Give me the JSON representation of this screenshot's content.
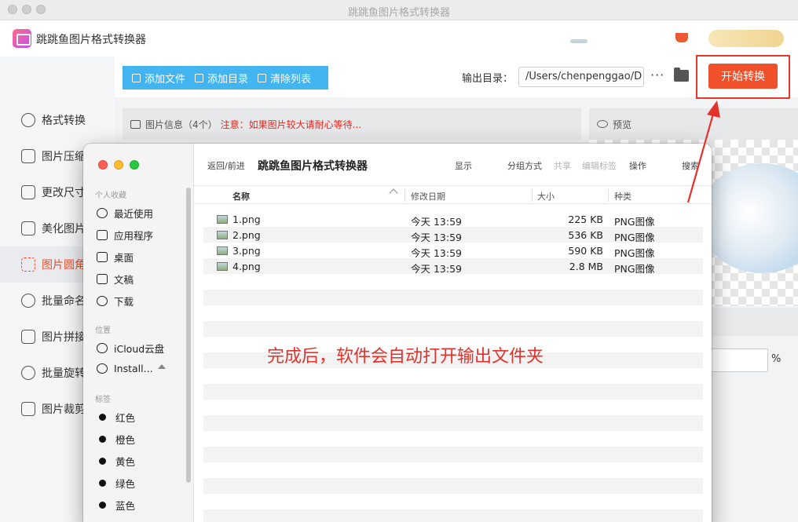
{
  "window": {
    "title": "跳跳鱼图片格式转换器"
  },
  "app": {
    "name": "跳跳鱼图片格式转换器"
  },
  "sidebar": {
    "items": [
      {
        "label": "格式转换",
        "icon": "format-convert-icon",
        "active": false
      },
      {
        "label": "图片压缩",
        "icon": "compress-icon",
        "active": false
      },
      {
        "label": "更改尺寸",
        "icon": "resize-icon",
        "active": false
      },
      {
        "label": "美化图片",
        "icon": "beautify-icon",
        "active": false
      },
      {
        "label": "图片圆角",
        "icon": "round-corner-icon",
        "active": true
      },
      {
        "label": "批量命名",
        "icon": "rename-icon",
        "active": false
      },
      {
        "label": "图片拼接",
        "icon": "join-icon",
        "active": false
      },
      {
        "label": "批量旋转",
        "icon": "rotate-icon",
        "active": false
      },
      {
        "label": "图片裁剪",
        "icon": "crop-icon",
        "active": false
      }
    ]
  },
  "toolbar": {
    "add_file": "添加文件",
    "add_dir": "添加目录",
    "clear_list": "清除列表",
    "output_label": "输出目录：",
    "output_path": "/Users/chenpenggao/D",
    "more": "···",
    "start": "开始转换"
  },
  "info_panel": {
    "label": "图片信息（4个）",
    "warning": "注意：如果图片较大请耐心等待..."
  },
  "preview_panel": {
    "label": "预览"
  },
  "settings": {
    "percent_unit": "%"
  },
  "finder": {
    "nav": "返回/前进",
    "title": "跳跳鱼图片格式转换器",
    "actions": {
      "view": "显示",
      "group": "分组方式",
      "share": "共享",
      "tags": "编辑标签",
      "action": "操作",
      "search": "搜索"
    },
    "sidebar": {
      "favorites_title": "个人收藏",
      "favorites": [
        "最近使用",
        "应用程序",
        "桌面",
        "文稿",
        "下载"
      ],
      "locations_title": "位置",
      "locations": [
        "iCloud云盘",
        "Install..."
      ],
      "tags_title": "标签",
      "tags": [
        {
          "label": "红色",
          "color": "#111111"
        },
        {
          "label": "橙色",
          "color": "#111111"
        },
        {
          "label": "黄色",
          "color": "#111111"
        },
        {
          "label": "绿色",
          "color": "#111111"
        },
        {
          "label": "蓝色",
          "color": "#111111"
        }
      ]
    },
    "columns": {
      "name": "名称",
      "date": "修改日期",
      "size": "大小",
      "kind": "种类"
    },
    "files": [
      {
        "name": "1.png",
        "date": "今天 13:59",
        "size": "225 KB",
        "kind": "PNG图像"
      },
      {
        "name": "2.png",
        "date": "今天 13:59",
        "size": "536 KB",
        "kind": "PNG图像"
      },
      {
        "name": "3.png",
        "date": "今天 13:59",
        "size": "590 KB",
        "kind": "PNG图像"
      },
      {
        "name": "4.png",
        "date": "今天 13:59",
        "size": "2.8 MB",
        "kind": "PNG图像"
      }
    ]
  },
  "annotation": {
    "text": "完成后，软件会自动打开输出文件夹"
  },
  "colors": {
    "accent": "#f0512b",
    "toolbar_blue": "#42b4ef",
    "annotation": "#e4312a",
    "warning": "#e02a20"
  }
}
